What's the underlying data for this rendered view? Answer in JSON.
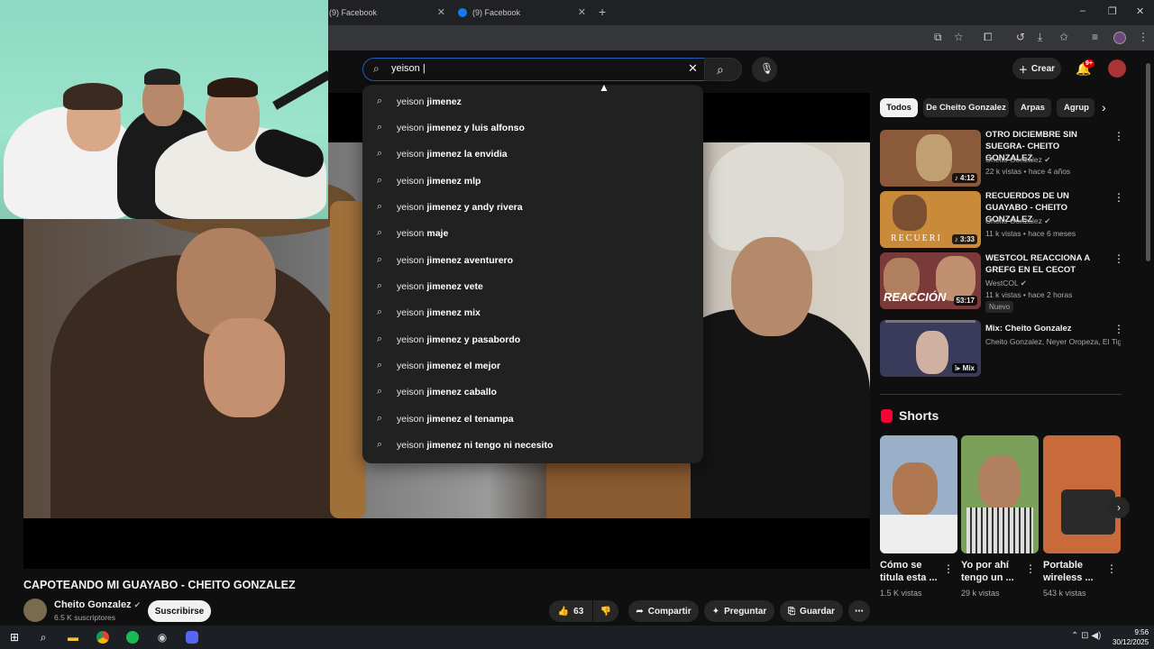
{
  "browser": {
    "tabs": [
      {
        "label": "(9) Facebook"
      },
      {
        "label": "(9) Facebook"
      }
    ],
    "new_tab": "+",
    "window_controls": {
      "minimize": "–",
      "maximize": "❐",
      "close": "✕"
    }
  },
  "search": {
    "query": "yeison |",
    "clear": "✕"
  },
  "suggestions": [
    {
      "prefix": "yeison",
      "rest": "jimenez"
    },
    {
      "prefix": "yeison",
      "rest": "jimenez y luis alfonso"
    },
    {
      "prefix": "yeison",
      "rest": "jimenez la envidia"
    },
    {
      "prefix": "yeison",
      "rest": "jimenez mlp"
    },
    {
      "prefix": "yeison",
      "rest": "jimenez y andy rivera"
    },
    {
      "prefix": "yeison",
      "rest": "maje"
    },
    {
      "prefix": "yeison",
      "rest": "jimenez aventurero"
    },
    {
      "prefix": "yeison",
      "rest": "jimenez vete"
    },
    {
      "prefix": "yeison",
      "rest": "jimenez mix"
    },
    {
      "prefix": "yeison",
      "rest": "jimenez y pasabordo"
    },
    {
      "prefix": "yeison",
      "rest": "jimenez el mejor"
    },
    {
      "prefix": "yeison",
      "rest": "jimenez caballo"
    },
    {
      "prefix": "yeison",
      "rest": "jimenez el tenampa"
    },
    {
      "prefix": "yeison",
      "rest": "jimenez ni tengo ni necesito"
    }
  ],
  "header": {
    "create_label": "Crear",
    "notifications_badge": "9+"
  },
  "video": {
    "title": "CAPOTEANDO MI GUAYABO - CHEITO GONZALEZ",
    "channel": "Cheito Gonzalez",
    "subscribers": "6.5 K suscriptores",
    "subscribe_label": "Suscribirse",
    "likes": "63",
    "share_label": "Compartir",
    "ask_label": "Preguntar",
    "save_label": "Guardar"
  },
  "chips": [
    {
      "label": "Todos"
    },
    {
      "label": "De Cheito Gonzalez"
    },
    {
      "label": "Arpas"
    },
    {
      "label": "Agrup"
    }
  ],
  "related": [
    {
      "title": "OTRO DICIEMBRE SIN SUEGRA- CHEITO GONZALEZ",
      "channel": "Cheito Gonzalez",
      "meta": "22 k vistas • hace 4 años",
      "duration": "♪ 4:12",
      "thumb_color": "#8a5a3a"
    },
    {
      "title": "RECUERDOS DE UN GUAYABO - CHEITO GONZALEZ",
      "channel": "Cheito Gonzalez",
      "meta": "11 k vistas • hace 6 meses",
      "duration": "♪ 3:33",
      "thumb_color": "#c98a3a",
      "thumb_text": "RECUERI"
    },
    {
      "title": "WESTCOL REACCIONA A GREFG EN EL CECOT",
      "channel": "WestCOL",
      "meta": "11 k vistas • hace 2 horas",
      "duration": "53:17",
      "thumb_color": "#7a3a3a",
      "thumb_text": "REACCIÓN",
      "badge": "Nuevo"
    },
    {
      "title": "Mix: Cheito Gonzalez",
      "channel": "Cheito Gonzalez, Neyer Oropeza, El Tigrit...",
      "meta": "",
      "duration": "Mix",
      "thumb_color": "#3a3a5a"
    }
  ],
  "shorts": {
    "heading": "Shorts",
    "items": [
      {
        "title": "Cómo se titula esta ...",
        "views": "1.5 K vistas",
        "color": "#9ab0c8"
      },
      {
        "title": "Yo por ahí tengo un ...",
        "views": "29 k vistas",
        "color": "#7aa05a"
      },
      {
        "title": "Portable wireless ...",
        "views": "543 k vistas",
        "color": "#c86a3a"
      }
    ]
  },
  "taskbar": {
    "time": "9:56",
    "date": "30/12/2025"
  }
}
